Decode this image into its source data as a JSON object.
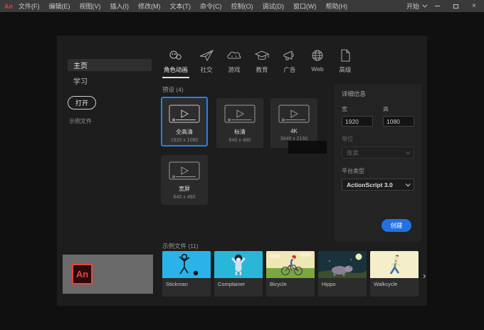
{
  "titlebar": {
    "logo": "An",
    "menus": [
      "文件(F)",
      "编辑(E)",
      "视图(V)",
      "插入(I)",
      "修改(M)",
      "文本(T)",
      "命令(C)",
      "控制(O)",
      "调试(D)",
      "窗口(W)",
      "帮助(H)"
    ],
    "start_label": "开始"
  },
  "sidebar": {
    "home": "主页",
    "learn": "学习",
    "open_button": "打开",
    "samples_link": "示例文件"
  },
  "tabs": [
    {
      "label": "角色动画",
      "icon": "character-icon"
    },
    {
      "label": "社交",
      "icon": "paper-plane-icon"
    },
    {
      "label": "游戏",
      "icon": "game-icon"
    },
    {
      "label": "教育",
      "icon": "graduation-cap-icon"
    },
    {
      "label": "广告",
      "icon": "megaphone-icon"
    },
    {
      "label": "Web",
      "icon": "globe-icon"
    },
    {
      "label": "高级",
      "icon": "document-icon"
    }
  ],
  "presets": {
    "label": "预设 (4)",
    "cards": [
      {
        "name": "全高清",
        "size": "1920 x 1080",
        "selected": true
      },
      {
        "name": "标清",
        "size": "640 x 480",
        "selected": false
      },
      {
        "name": "4K",
        "size": "3840 x 2160",
        "selected": false
      },
      {
        "name": "宽屏",
        "size": "640 x 480",
        "selected": false
      }
    ]
  },
  "details": {
    "title": "详细信息",
    "width_label": "宽",
    "width_value": "1920",
    "height_label": "高",
    "height_value": "1080",
    "unit_label": "单位",
    "unit_value": "像素",
    "platform_label": "平台类型",
    "platform_value": "ActionScript 3.0",
    "create_button": "创建"
  },
  "samples": {
    "label": "示例文件 (11)",
    "items": [
      {
        "name": "Stickman"
      },
      {
        "name": "Complainer"
      },
      {
        "name": "Bicycle"
      },
      {
        "name": "Hippo"
      },
      {
        "name": "Walkcycle"
      }
    ],
    "next_arrow": "›"
  },
  "colors": {
    "accent_blue": "#2271e4",
    "selected_border": "#2680eb",
    "logo_red": "#e8453c",
    "titlebar_bg": "#3a3a3a",
    "panel_bg": "#1d1d1d"
  }
}
